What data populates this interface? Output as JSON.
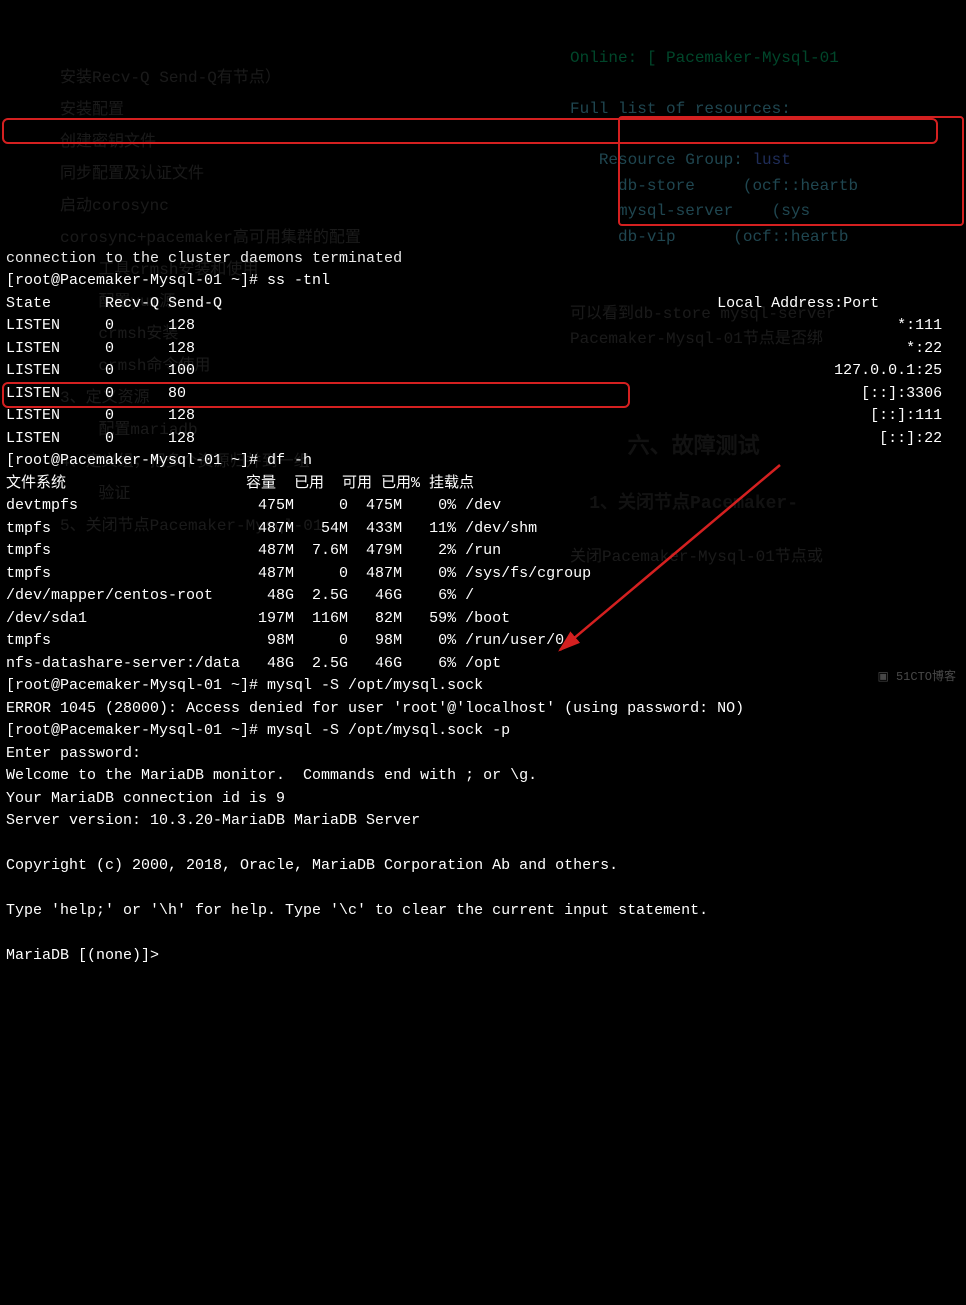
{
  "lines": {
    "l0": "connection to the cluster daemons terminated",
    "prompt1": "[root@Pacemaker-Mysql-01 ~]# ",
    "cmd1": "ss -tnl",
    "ss_header_left": "State      Recv-Q Send-Q",
    "ss_header_right": "Local Address:Port",
    "ss_r1_l": "LISTEN     0      128",
    "ss_r1_r": "*:111",
    "ss_r2_l": "LISTEN     0      128",
    "ss_r2_r": "*:22",
    "ss_r3_l": "LISTEN     0      100",
    "ss_r3_r": "127.0.0.1:25",
    "ss_r4_l": "LISTEN     0      80",
    "ss_r4_r": "[::]:3306",
    "ss_r5_l": "LISTEN     0      128",
    "ss_r5_r": "[::]:111",
    "ss_r6_l": "LISTEN     0      128",
    "ss_r6_r": "[::]:22",
    "prompt2": "[root@Pacemaker-Mysql-01 ~]# ",
    "cmd2": "df -h",
    "df_header": "文件系统                    容量  已用  可用 已用% 挂载点",
    "df1": "devtmpfs                    475M     0  475M    0% /dev",
    "df2": "tmpfs                       487M   54M  433M   11% /dev/shm",
    "df3": "tmpfs                       487M  7.6M  479M    2% /run",
    "df4": "tmpfs                       487M     0  487M    0% /sys/fs/cgroup",
    "df5": "/dev/mapper/centos-root      48G  2.5G   46G    6% /",
    "df6": "/dev/sda1                   197M  116M   82M   59% /boot",
    "df7": "tmpfs                        98M     0   98M    0% /run/user/0",
    "df8": "nfs-datashare-server:/data   48G  2.5G   46G    6% /opt",
    "prompt3": "[root@Pacemaker-Mysql-01 ~]# ",
    "cmd3": "mysql -S /opt/mysql.sock",
    "err1": "ERROR 1045 (28000): Access denied for user 'root'@'localhost' (using password: NO)",
    "prompt4": "[root@Pacemaker-Mysql-01 ~]# ",
    "cmd4": "mysql -S /opt/mysql.sock -p",
    "enter_pw": "Enter password:",
    "welcome1": "Welcome to the MariaDB monitor.  Commands end with ; or \\g.",
    "welcome2": "Your MariaDB connection id is 9",
    "welcome3": "Server version: 10.3.20-MariaDB MariaDB Server",
    "copyright": "Copyright (c) 2000, 2018, Oracle, MariaDB Corporation Ab and others.",
    "helpline": "Type 'help;' or '\\h' for help. Type '\\c' to clear the current input statement.",
    "mariadb_prompt": "MariaDB [(none)]> "
  },
  "ghost": {
    "g1": "安装Recv-Q Send-Q有节点）",
    "g2": "安装配置",
    "g3": "创建密钥文件",
    "g4": "同步配置及认证文件",
    "g5": "启动corosync",
    "g6": "corosync+pacemaker高可用集群的配置",
    "g7": "工具crmsh安装和使用",
    "g8": "配置yum源",
    "g9": "crmsh安装",
    "g10": "crmsh命令使用",
    "g11": "3、定义资源",
    "g12": "配置mariadb",
    "g13": "4、定义组，把多个资源归并到一组",
    "g14": "验证",
    "g15": "5、关闭节点Pacemaker-Mysql-01",
    "online": "Online: [ Pacemaker-Mysql-01",
    "full": "Full list of resources:",
    "rgroup": "Resource Group: ",
    "rgroup_name": "lust",
    "rs1": "db-store",
    "rs1t": "(ocf::heartb",
    "rs2": "mysql-server",
    "rs2t": "(sys",
    "rs3": "db-vip",
    "rs3t": "(ocf::heartb",
    "cn1": "可以看到db-store mysql-server",
    "cn2": "Pacemaker-Mysql-01节点是否绑",
    "head1": "六、故障测试",
    "sub1": "1、关闭节点Pacemaker-",
    "cn3": "关闭Pacemaker-Mysql-01节点或"
  },
  "watermark": "51CTO博客"
}
